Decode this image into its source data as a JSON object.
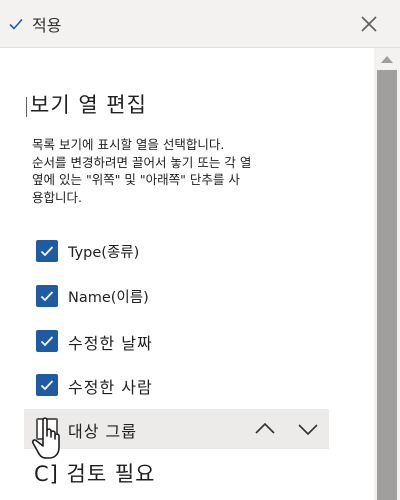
{
  "header": {
    "apply_label": "적용",
    "icons": {
      "apply": "checkmark-icon",
      "close": "close-icon"
    }
  },
  "panel": {
    "title": "보기 열 편집",
    "description_lines": [
      "목록 보기에 표시할 열을 선택합니다.",
      "순서를 변경하려면 끌어서 놓기 또는 각 열",
      "옆에 있는 \"위쪽\" 및 \"아래쪽\" 단추를 사",
      "용합니다."
    ],
    "columns": [
      {
        "label": "Type(종류)",
        "checked": true
      },
      {
        "label": "Name(이름)",
        "checked": true
      },
      {
        "label": "수정한 날짜",
        "checked": true
      },
      {
        "label": "수정한 사람",
        "checked": true
      },
      {
        "label": "대상 그룹",
        "checked": false,
        "selected": true
      }
    ],
    "move_icons": {
      "up": "chevron-up-icon",
      "down": "chevron-down-icon"
    },
    "review_note": "C] 검토 필요"
  },
  "colors": {
    "checkbox": "#1e5ba3",
    "header_bg": "#f3f2f1",
    "selected_row": "#edebe9",
    "scroll_thumb": "#a19f9d"
  }
}
